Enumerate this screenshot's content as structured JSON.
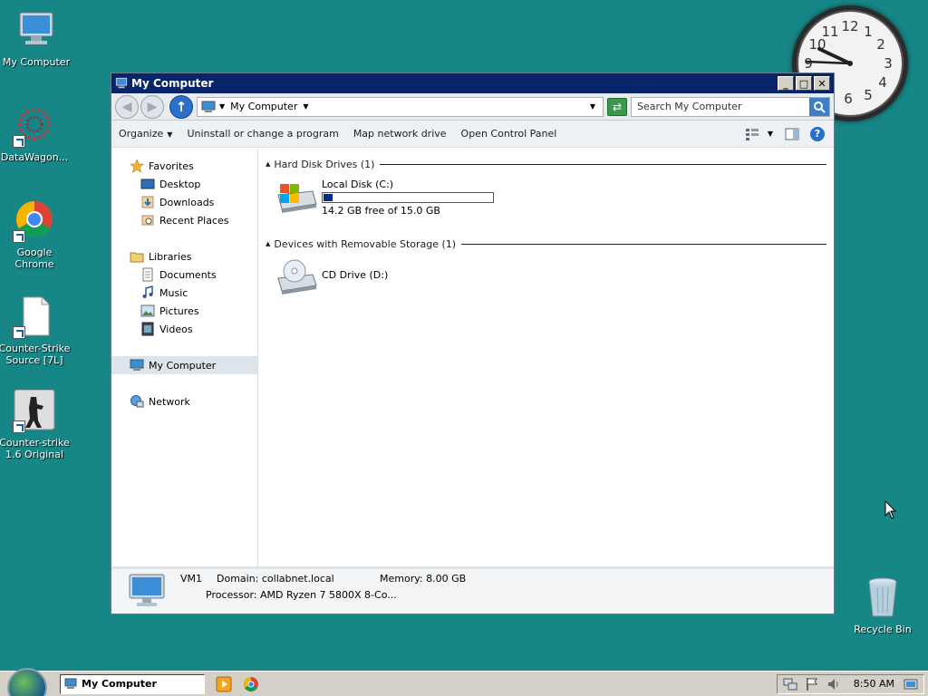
{
  "desktop": {
    "icons": [
      {
        "label": "My Computer"
      },
      {
        "label": "DataWagon..."
      },
      {
        "label": "Google Chrome"
      },
      {
        "label": "Counter-Strike Source [7L]"
      },
      {
        "label": "Counter-strike 1.6 Original"
      },
      {
        "label": "Recycle Bin"
      }
    ],
    "clock_numbers": [
      "12",
      "1",
      "2",
      "3",
      "4",
      "5",
      "6",
      "9",
      "10",
      "11"
    ]
  },
  "window": {
    "title": "My Computer",
    "address": {
      "crumb": "My Computer"
    },
    "search": {
      "placeholder": "Search My Computer"
    },
    "commands": {
      "organize": "Organize",
      "uninstall": "Uninstall or change a program",
      "map_drive": "Map network drive",
      "control_panel": "Open Control Panel"
    },
    "nav": {
      "favorites": "Favorites",
      "desktop": "Desktop",
      "downloads": "Downloads",
      "recent": "Recent Places",
      "libraries": "Libraries",
      "documents": "Documents",
      "music": "Music",
      "pictures": "Pictures",
      "videos": "Videos",
      "my_computer": "My Computer",
      "network": "Network"
    },
    "groups": {
      "hdd": {
        "title": "Hard Disk Drives (1)"
      },
      "removable": {
        "title": "Devices with Removable Storage (1)"
      }
    },
    "drives": {
      "c": {
        "name": "Local Disk (C:)",
        "space": "14.2 GB free of 15.0 GB",
        "used_fraction": 0.053
      },
      "d": {
        "name": "CD Drive (D:)"
      }
    },
    "details": {
      "name": "VM1",
      "domain": "Domain: collabnet.local",
      "memory": "Memory: 8.00 GB",
      "processor": "Processor: AMD Ryzen 7 5800X 8-Co..."
    }
  },
  "taskbar": {
    "active_window": "My Computer",
    "time": "8:50 AM"
  },
  "colors": {
    "desktop": "#178686",
    "titlebar": "#0a246a",
    "disk_bar": "#0a2a8a"
  }
}
